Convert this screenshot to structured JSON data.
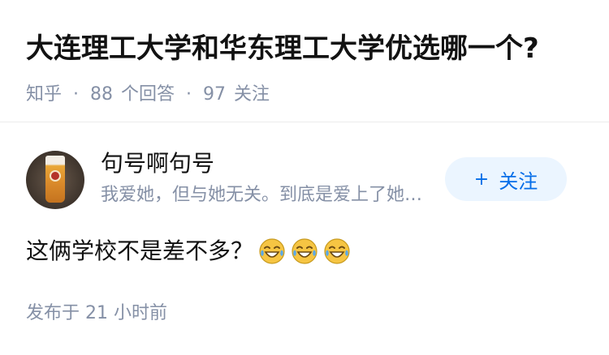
{
  "question": {
    "title": "大连理工大学和华东理工大学优选哪一个?",
    "source": "知乎",
    "answer_count": "88",
    "answer_label": "个回答",
    "follow_count": "97",
    "follow_label": "关注",
    "separator": "·"
  },
  "answer": {
    "author": {
      "name": "句号啊句号",
      "bio": "我爱她，但与她无关。到底是爱上了她还是爱上了爱",
      "follow_button": {
        "icon": "+",
        "label": "关注"
      }
    },
    "text": "这俩学校不是差不多？",
    "emojis": [
      "laughing-tears-emoji",
      "laughing-tears-emoji",
      "laughing-tears-emoji"
    ],
    "published": "发布于 21 小时前"
  },
  "colors": {
    "text_primary": "#121212",
    "text_secondary": "#8590a6",
    "accent": "#056de8",
    "accent_bg": "#ebf5ff"
  }
}
